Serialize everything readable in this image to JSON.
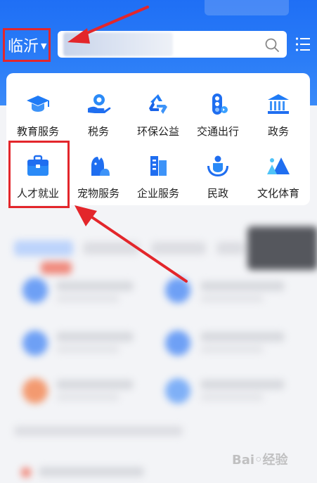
{
  "header": {
    "city": "临沂",
    "city_caret": "▼"
  },
  "search": {
    "placeholder": ""
  },
  "services": [
    {
      "label": "教育服务",
      "icon": "graduation-cap-icon"
    },
    {
      "label": "税务",
      "icon": "tax-hand-icon"
    },
    {
      "label": "环保公益",
      "icon": "recycle-icon"
    },
    {
      "label": "交通出行",
      "icon": "traffic-light-icon"
    },
    {
      "label": "政务",
      "icon": "government-building-icon"
    },
    {
      "label": "人才就业",
      "icon": "briefcase-icon"
    },
    {
      "label": "宠物服务",
      "icon": "pet-icon"
    },
    {
      "label": "企业服务",
      "icon": "enterprise-building-icon"
    },
    {
      "label": "民政",
      "icon": "civil-affairs-icon"
    },
    {
      "label": "文化体育",
      "icon": "culture-sports-icon"
    }
  ],
  "colors": {
    "brand": "#2a7cf7",
    "annotation": "#e3262b"
  }
}
